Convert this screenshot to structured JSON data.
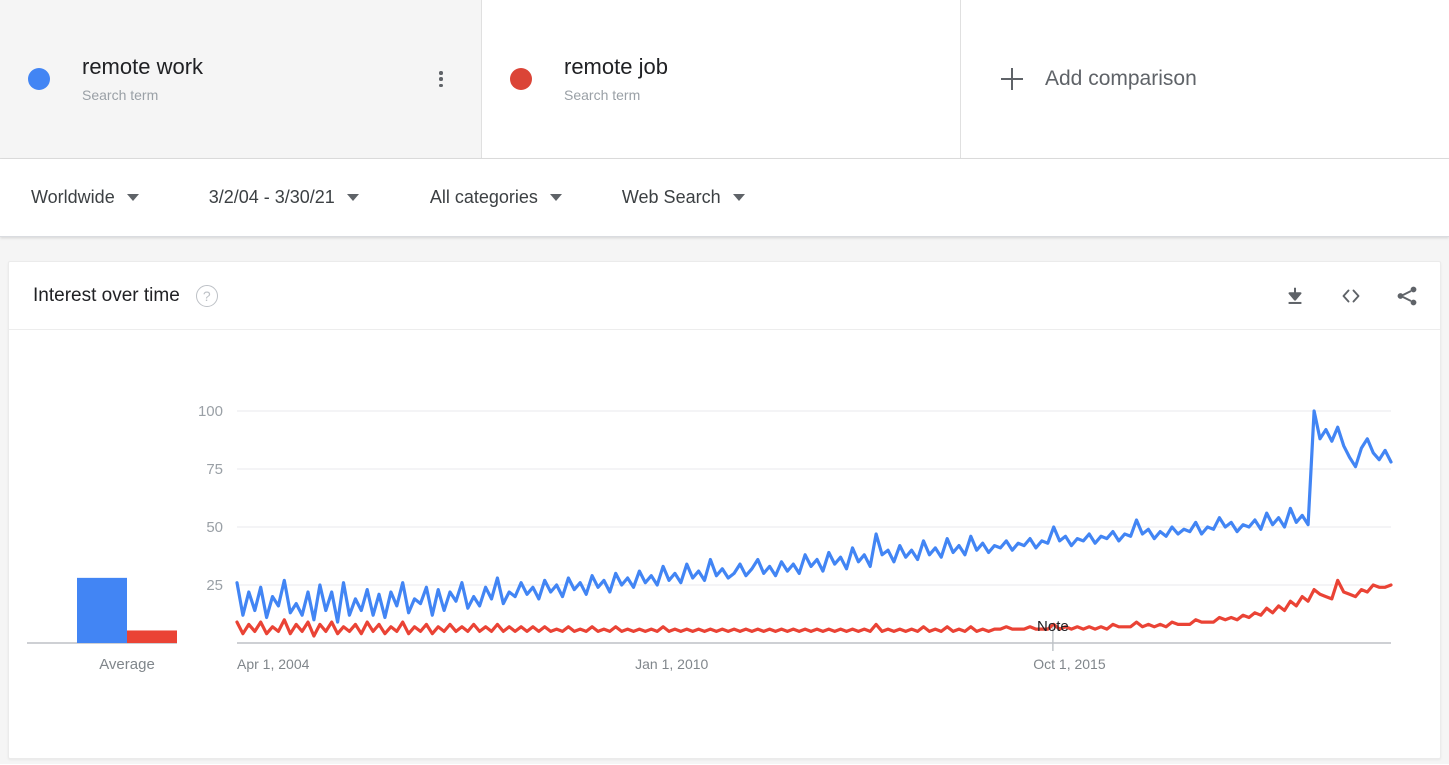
{
  "terms": [
    {
      "name": "remote work",
      "type_label": "Search term",
      "color": "#4285F4",
      "selected": true
    },
    {
      "name": "remote job",
      "type_label": "Search term",
      "color": "#DB4437",
      "selected": false
    }
  ],
  "add_comparison": {
    "label": "Add comparison",
    "icon": "plus-icon"
  },
  "filters": [
    {
      "label": "Worldwide",
      "name": "location"
    },
    {
      "label": "3/2/04 - 3/30/21",
      "name": "date-range"
    },
    {
      "label": "All categories",
      "name": "category"
    },
    {
      "label": "Web Search",
      "name": "search-type"
    }
  ],
  "card": {
    "title": "Interest over time",
    "help_icon": "?",
    "actions": [
      "download-icon",
      "embed-icon",
      "share-icon"
    ]
  },
  "chart_data": {
    "type": "line",
    "title": "Interest over time",
    "xlabel": "",
    "ylabel": "",
    "ylim": [
      0,
      100
    ],
    "yticks": [
      25,
      50,
      75,
      100
    ],
    "grid": true,
    "legend_position": "top",
    "xticks": [
      "Apr 1, 2004",
      "Jan 1, 2010",
      "Oct 1, 2015"
    ],
    "xtick_positions": [
      0.0,
      0.345,
      0.69
    ],
    "annotations": [
      {
        "text": "Note",
        "x_frac": 0.707,
        "y_value": 7
      }
    ],
    "average": {
      "label": "Average",
      "values": [
        26,
        5
      ],
      "colors": [
        "#4285F4",
        "#EA4335"
      ]
    },
    "series": [
      {
        "name": "remote work",
        "color": "#4285F4",
        "values": [
          26,
          12,
          22,
          14,
          24,
          11,
          20,
          16,
          27,
          13,
          17,
          12,
          22,
          10,
          25,
          14,
          22,
          9,
          26,
          12,
          19,
          14,
          23,
          12,
          21,
          11,
          22,
          16,
          26,
          13,
          19,
          17,
          24,
          12,
          23,
          14,
          22,
          18,
          26,
          15,
          20,
          16,
          24,
          19,
          28,
          17,
          22,
          20,
          26,
          21,
          24,
          19,
          27,
          22,
          25,
          20,
          28,
          23,
          26,
          21,
          29,
          24,
          27,
          22,
          30,
          25,
          28,
          24,
          31,
          26,
          29,
          25,
          33,
          27,
          30,
          26,
          34,
          28,
          31,
          27,
          36,
          29,
          32,
          28,
          30,
          34,
          29,
          32,
          36,
          30,
          33,
          29,
          35,
          31,
          34,
          30,
          38,
          33,
          36,
          31,
          39,
          34,
          37,
          32,
          41,
          35,
          38,
          33,
          47,
          38,
          40,
          35,
          42,
          37,
          40,
          36,
          44,
          38,
          41,
          37,
          45,
          39,
          42,
          38,
          46,
          40,
          43,
          39,
          42,
          41,
          44,
          40,
          43,
          42,
          45,
          41,
          44,
          43,
          50,
          44,
          46,
          42,
          45,
          44,
          47,
          43,
          46,
          45,
          48,
          44,
          47,
          46,
          53,
          47,
          49,
          45,
          48,
          46,
          50,
          47,
          49,
          48,
          52,
          47,
          50,
          49,
          54,
          50,
          52,
          48,
          51,
          50,
          53,
          49,
          56,
          51,
          54,
          50,
          58,
          52,
          55,
          51,
          100,
          88,
          92,
          87,
          93,
          85,
          80,
          76,
          84,
          88,
          82,
          79,
          83,
          78
        ]
      },
      {
        "name": "remote job",
        "color": "#EA4335",
        "values": [
          9,
          4,
          8,
          5,
          9,
          4,
          7,
          5,
          10,
          4,
          8,
          5,
          9,
          3,
          8,
          5,
          9,
          4,
          7,
          5,
          8,
          4,
          9,
          5,
          8,
          4,
          7,
          5,
          9,
          4,
          7,
          5,
          8,
          4,
          7,
          5,
          8,
          5,
          7,
          5,
          8,
          5,
          7,
          5,
          8,
          5,
          7,
          5,
          7,
          5,
          7,
          5,
          7,
          5,
          6,
          5,
          7,
          5,
          6,
          5,
          7,
          5,
          6,
          5,
          7,
          5,
          6,
          5,
          6,
          5,
          6,
          5,
          7,
          5,
          6,
          5,
          6,
          5,
          6,
          5,
          6,
          5,
          6,
          5,
          6,
          5,
          6,
          5,
          6,
          5,
          6,
          5,
          6,
          5,
          6,
          5,
          6,
          5,
          6,
          5,
          6,
          5,
          6,
          5,
          6,
          5,
          6,
          5,
          8,
          5,
          6,
          5,
          6,
          5,
          6,
          5,
          7,
          5,
          6,
          5,
          7,
          5,
          6,
          5,
          7,
          5,
          6,
          5,
          6,
          6,
          7,
          6,
          6,
          6,
          7,
          6,
          6,
          6,
          8,
          6,
          7,
          6,
          7,
          6,
          7,
          6,
          7,
          6,
          8,
          7,
          7,
          7,
          9,
          7,
          8,
          7,
          8,
          7,
          9,
          8,
          8,
          8,
          10,
          9,
          9,
          9,
          11,
          10,
          11,
          10,
          12,
          11,
          13,
          12,
          15,
          13,
          16,
          14,
          18,
          16,
          20,
          18,
          23,
          21,
          20,
          19,
          27,
          22,
          21,
          20,
          23,
          22,
          25,
          24,
          24,
          25
        ]
      }
    ]
  }
}
